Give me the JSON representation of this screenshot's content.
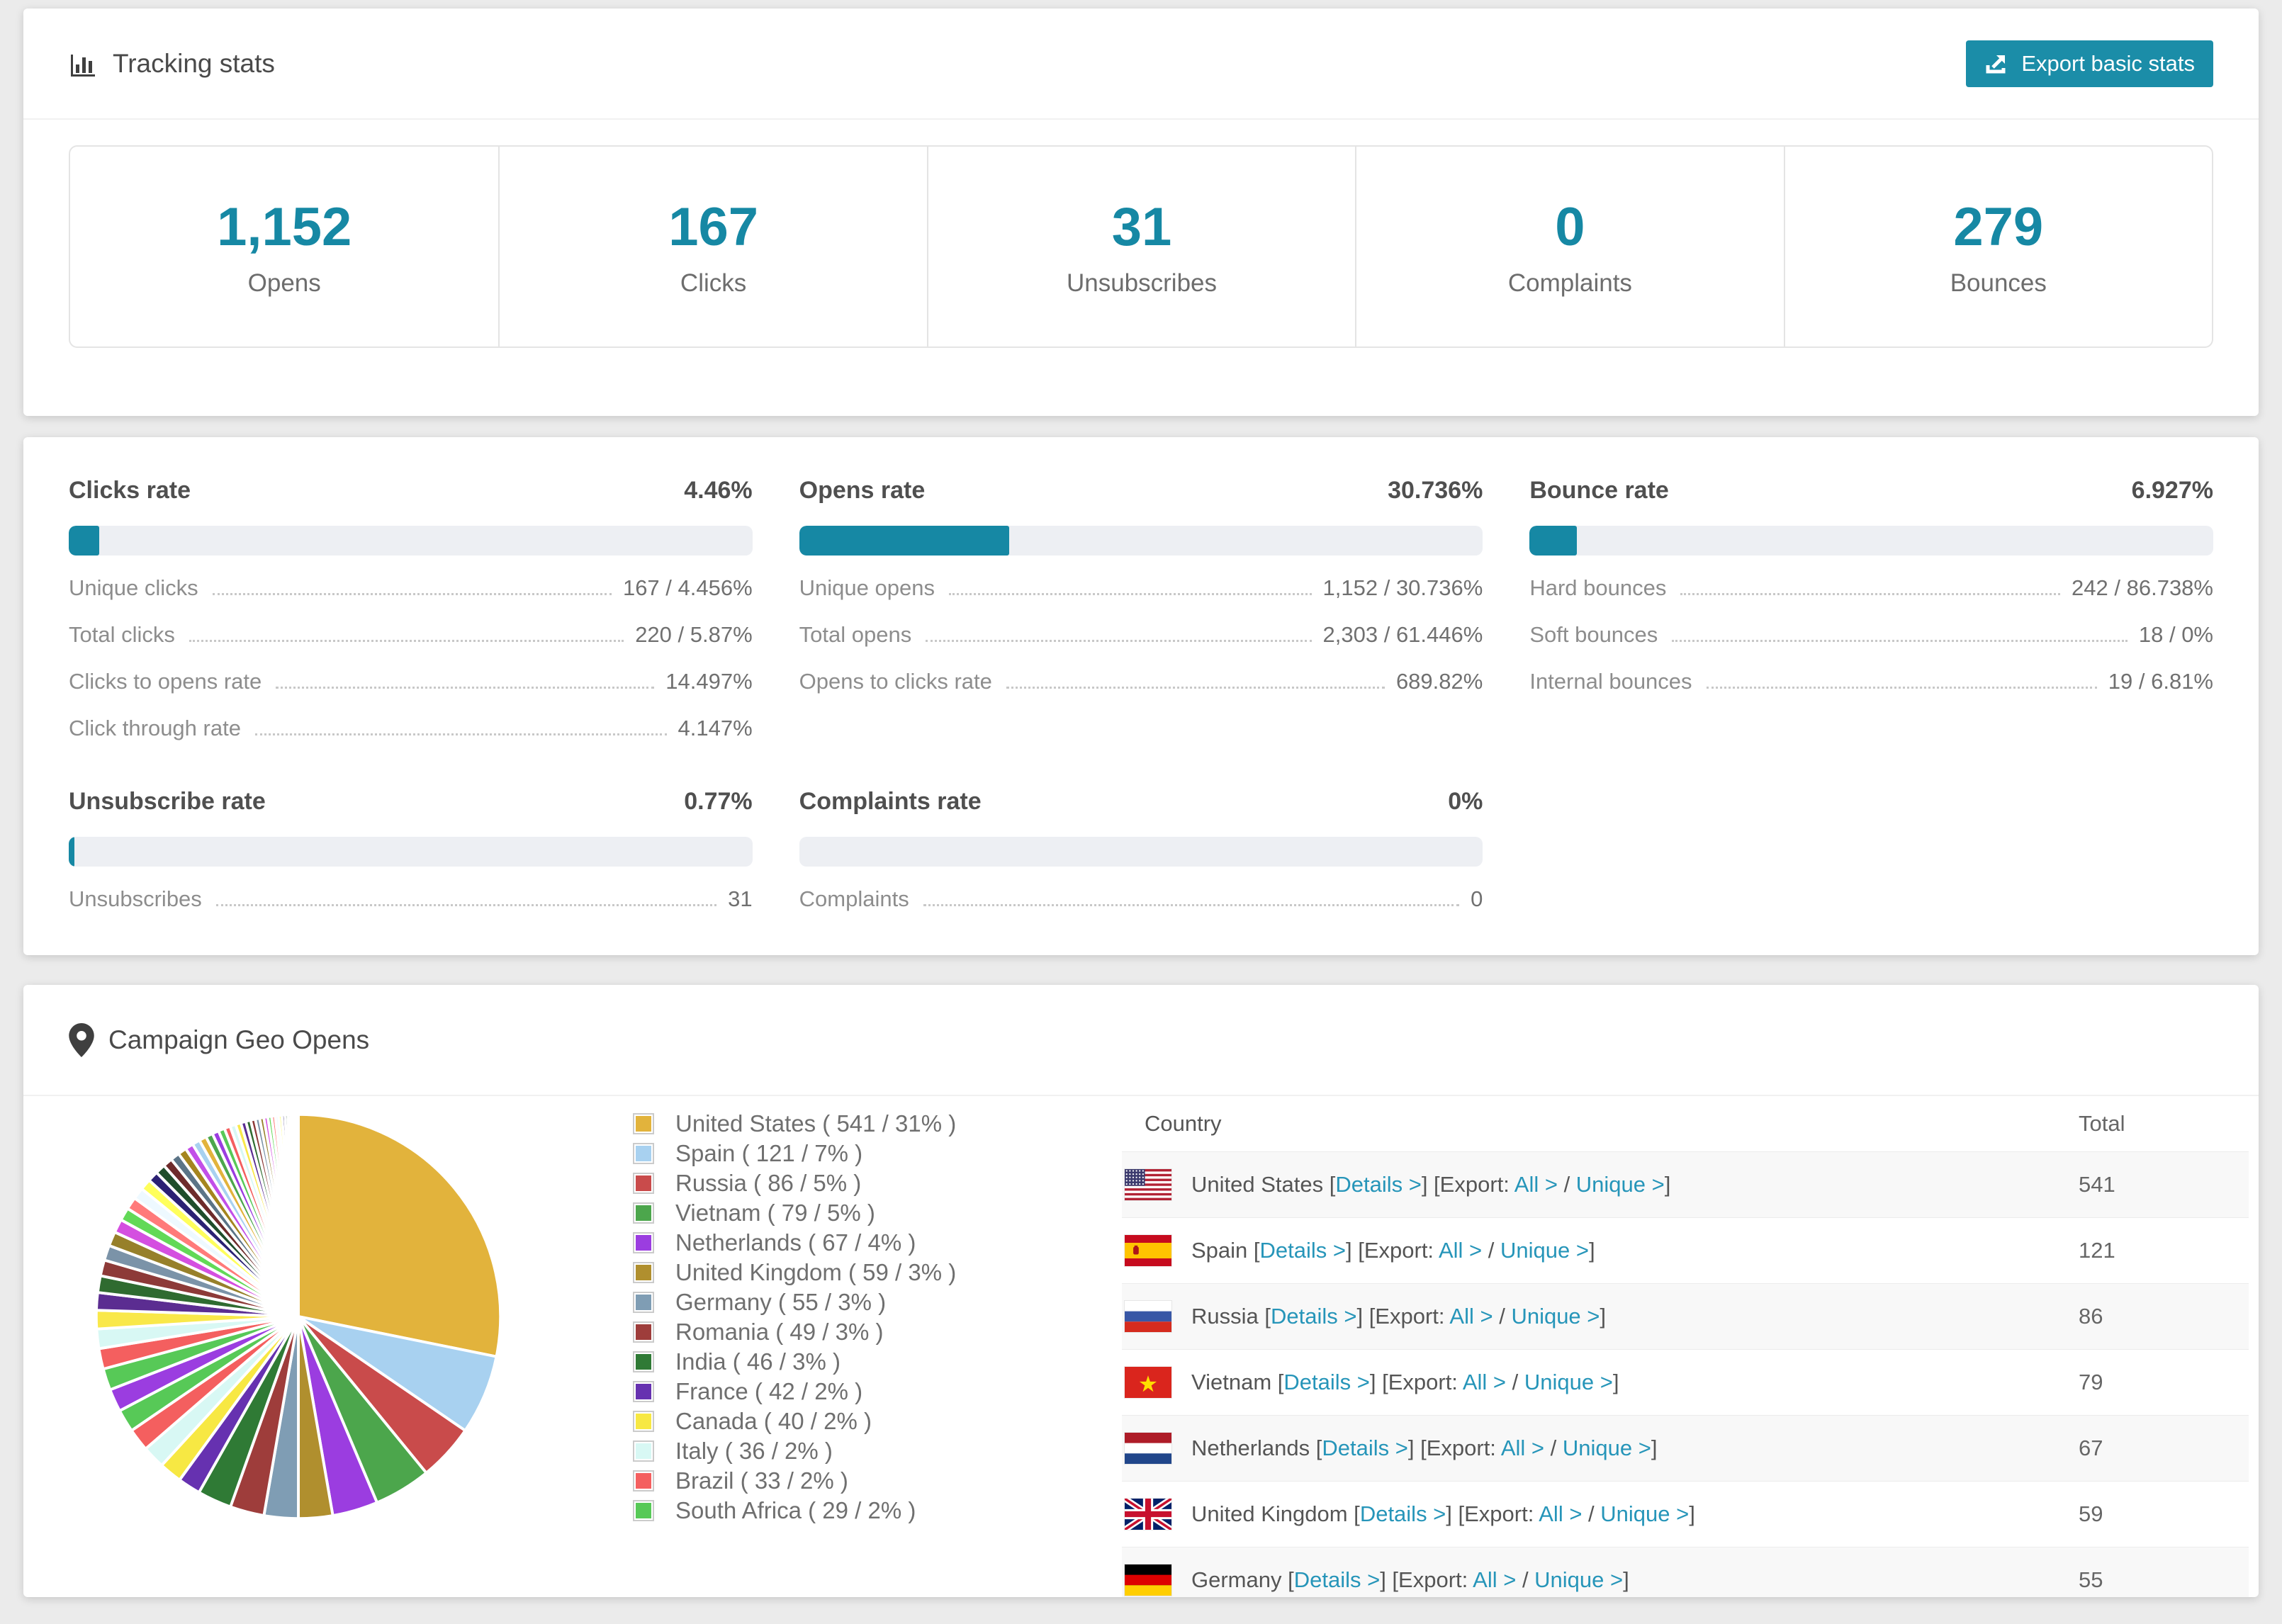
{
  "tracking": {
    "title": "Tracking stats",
    "export_button": {
      "label": "Export basic stats"
    },
    "stats": [
      {
        "value": "1,152",
        "label": "Opens"
      },
      {
        "value": "167",
        "label": "Clicks"
      },
      {
        "value": "31",
        "label": "Unsubscribes"
      },
      {
        "value": "0",
        "label": "Complaints"
      },
      {
        "value": "279",
        "label": "Bounces"
      }
    ]
  },
  "rates": [
    {
      "title": "Clicks rate",
      "value": "4.46%",
      "percent": 4.46,
      "details": [
        {
          "label": "Unique clicks",
          "value": "167 / 4.456%"
        },
        {
          "label": "Total clicks",
          "value": "220 / 5.87%"
        },
        {
          "label": "Clicks to opens rate",
          "value": "14.497%"
        },
        {
          "label": "Click through rate",
          "value": "4.147%"
        }
      ]
    },
    {
      "title": "Opens rate",
      "value": "30.736%",
      "percent": 30.736,
      "details": [
        {
          "label": "Unique opens",
          "value": "1,152 / 30.736%"
        },
        {
          "label": "Total opens",
          "value": "2,303 / 61.446%"
        },
        {
          "label": "Opens to clicks rate",
          "value": "689.82%"
        }
      ]
    },
    {
      "title": "Bounce rate",
      "value": "6.927%",
      "percent": 6.927,
      "details": [
        {
          "label": "Hard bounces",
          "value": "242 / 86.738%"
        },
        {
          "label": "Soft bounces",
          "value": "18 / 0%"
        },
        {
          "label": "Internal bounces",
          "value": "19 / 6.81%"
        }
      ]
    },
    {
      "title": "Unsubscribe rate",
      "value": "0.77%",
      "percent": 0.77,
      "details": [
        {
          "label": "Unsubscribes",
          "value": "31"
        }
      ]
    },
    {
      "title": "Complaints rate",
      "value": "0%",
      "percent": 0,
      "details": [
        {
          "label": "Complaints",
          "value": "0"
        }
      ]
    }
  ],
  "geo": {
    "title": "Campaign Geo Opens",
    "table": {
      "headers": [
        "Country",
        "Total"
      ],
      "link_labels": {
        "details": "Details >",
        "export_prefix": "Export:",
        "all": "All >",
        "unique": "Unique >"
      },
      "rows": [
        {
          "country": "United States",
          "flag": "us",
          "total": "541"
        },
        {
          "country": "Spain",
          "flag": "es",
          "total": "121"
        },
        {
          "country": "Russia",
          "flag": "ru",
          "total": "86"
        },
        {
          "country": "Vietnam",
          "flag": "vn",
          "total": "79"
        },
        {
          "country": "Netherlands",
          "flag": "nl",
          "total": "67"
        },
        {
          "country": "United Kingdom",
          "flag": "gb",
          "total": "59"
        },
        {
          "country": "Germany",
          "flag": "de",
          "total": "55"
        }
      ]
    },
    "chart_data": {
      "type": "pie",
      "title": "Campaign Geo Opens",
      "legend_position": "right-of-chart",
      "legend_format": "{label} ( {value} / {pct}% )",
      "series": [
        {
          "label": "United States",
          "value": 541,
          "pct": 31,
          "color": "#e2b33c"
        },
        {
          "label": "Spain",
          "value": 121,
          "pct": 7,
          "color": "#a8d1f0"
        },
        {
          "label": "Russia",
          "value": 86,
          "pct": 5,
          "color": "#c94b4b"
        },
        {
          "label": "Vietnam",
          "value": 79,
          "pct": 5,
          "color": "#4ca64c"
        },
        {
          "label": "Netherlands",
          "value": 67,
          "pct": 4,
          "color": "#9b3de0"
        },
        {
          "label": "United Kingdom",
          "value": 59,
          "pct": 3,
          "color": "#b08f2e"
        },
        {
          "label": "Germany",
          "value": 55,
          "pct": 3,
          "color": "#7f9db4"
        },
        {
          "label": "Romania",
          "value": 49,
          "pct": 3,
          "color": "#9e3d3b"
        },
        {
          "label": "India",
          "value": 46,
          "pct": 3,
          "color": "#2f7a35"
        },
        {
          "label": "France",
          "value": 42,
          "pct": 2,
          "color": "#6631b0"
        },
        {
          "label": "Canada",
          "value": 40,
          "pct": 2,
          "color": "#f7e843"
        },
        {
          "label": "Italy",
          "value": 36,
          "pct": 2,
          "color": "#d8f8f4"
        },
        {
          "label": "Brazil",
          "value": 33,
          "pct": 2,
          "color": "#f45f5f"
        },
        {
          "label": "South Africa",
          "value": 29,
          "pct": 2,
          "color": "#57c957"
        }
      ],
      "others_unlabeled": {
        "approx_total_pct": 36,
        "slice_count": 45,
        "first_pct": 2.0,
        "decay": 0.95,
        "palette": [
          "#9b3de0",
          "#57c957",
          "#f45f5f",
          "#d8f8f4",
          "#f9e84a",
          "#5b2d91",
          "#2f6b30",
          "#8d3a38",
          "#7b93a8",
          "#97802a",
          "#d44fe0",
          "#62d957",
          "#ff7a7a",
          "#eef9ff",
          "#ffff5c",
          "#2b2173",
          "#1f4d2b",
          "#6e2b2b",
          "#5b7487",
          "#a5851f",
          "#c24fe8",
          "#a8d1f0",
          "#e2b33c",
          "#4ca64c"
        ]
      }
    }
  }
}
